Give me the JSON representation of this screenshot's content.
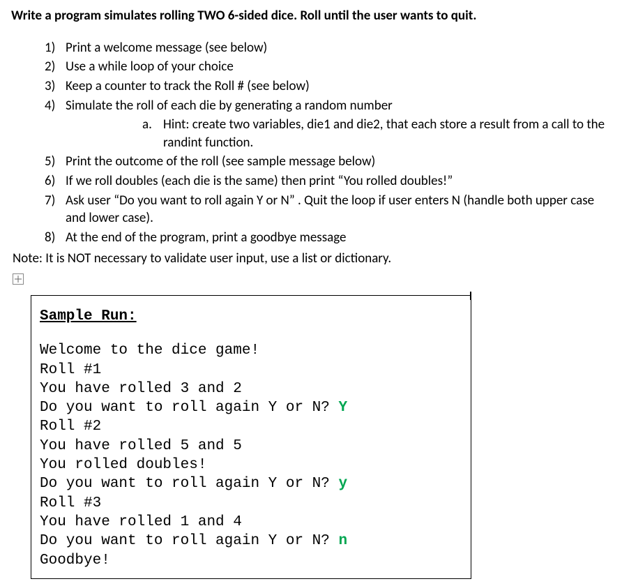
{
  "title": "Write a program simulates rolling TWO 6-sided dice.  Roll until the user wants to quit.",
  "items": [
    {
      "num": "1)",
      "text": "Print a welcome message (see below)"
    },
    {
      "num": "2)",
      "text": "Use a while loop of your choice"
    },
    {
      "num": "3)",
      "text": "Keep a counter to track the Roll # (see below)"
    },
    {
      "num": "4)",
      "text": "Simulate the roll of each die by generating a random number"
    },
    {
      "num": "5)",
      "text": "Print the outcome of the roll (see sample message below)"
    },
    {
      "num": "6)",
      "text": "If we roll doubles (each die is the same) then print “You rolled doubles!”"
    },
    {
      "num": "7)",
      "text": "Ask user “Do you want to roll again Y or N” .  Quit the loop if user enters N (handle both upper case and lower case)."
    },
    {
      "num": "8)",
      "text": "At the end of the program, print a goodbye message"
    }
  ],
  "subitem": {
    "num": "a.",
    "text": "Hint:  create two variables, die1 and die2, that each store a result from a call to the randint function."
  },
  "note": "Note:  It is NOT necessary to validate user input, use a list or dictionary.",
  "sample": {
    "header": "Sample Run:",
    "lines": [
      {
        "text": "Welcome to the dice game!",
        "input": ""
      },
      {
        "text": "Roll #1",
        "input": ""
      },
      {
        "text": "You have rolled 3 and 2",
        "input": ""
      },
      {
        "text": "Do you want to roll again Y or N? ",
        "input": "Y"
      },
      {
        "text": "Roll #2",
        "input": ""
      },
      {
        "text": "You have rolled 5 and 5",
        "input": ""
      },
      {
        "text": "You rolled doubles!",
        "input": ""
      },
      {
        "text": "Do you want to roll again Y or N? ",
        "input": "y"
      },
      {
        "text": "Roll #3",
        "input": ""
      },
      {
        "text": "You have rolled 1 and 4",
        "input": ""
      },
      {
        "text": "Do you want to roll again Y or N? ",
        "input": "n"
      },
      {
        "text": "Goodbye!",
        "input": ""
      }
    ]
  }
}
